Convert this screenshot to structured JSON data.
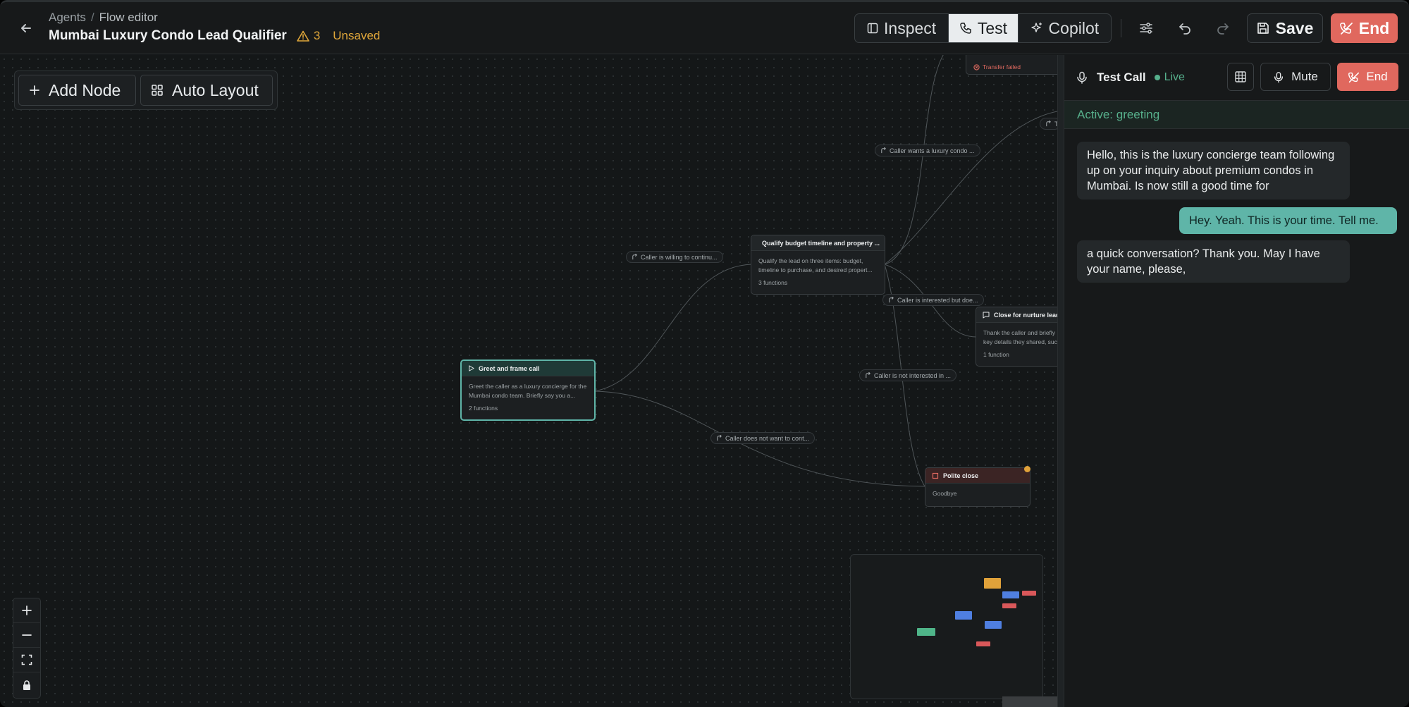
{
  "header": {
    "breadcrumb": {
      "root": "Agents",
      "separator": "/",
      "current": "Flow editor"
    },
    "title": "Mumbai Luxury Condo Lead Qualifier",
    "warning_count": "3",
    "unsaved_label": "Unsaved",
    "modes": [
      {
        "label": "Inspect",
        "icon": "panel-icon",
        "active": false
      },
      {
        "label": "Test",
        "icon": "phone-icon",
        "active": true
      },
      {
        "label": "Copilot",
        "icon": "sparkle-icon",
        "active": false
      }
    ],
    "save_label": "Save",
    "end_label": "End"
  },
  "toolbar": {
    "add_node_label": "Add Node",
    "auto_layout_label": "Auto Layout"
  },
  "flow": {
    "nodes": {
      "greet": {
        "title": "Greet and frame call",
        "body": "Greet the caller as a luxury concierge for the Mumbai condo team. Briefly say you a...",
        "meta": "2 functions"
      },
      "qualify": {
        "title": "Qualify budget timeline and property ...",
        "body": "Qualify the lead on three items: budget, timeline to purchase, and desired propert...",
        "meta": "3 functions"
      },
      "nurture": {
        "title": "Close for nurture lead",
        "body": "Thank the caller and briefly key details they shared, suc",
        "meta": "1 function"
      },
      "polite": {
        "title": "Polite close",
        "body": "Goodbye"
      },
      "transfer": {
        "error": "Transfer failed"
      }
    },
    "edge_labels": {
      "willing": "Caller is willing to continu...",
      "not_continue": "Caller does not want to cont...",
      "luxury": "Caller wants a luxury condo ...",
      "interested_but": "Caller is interested but doe...",
      "not_interested": "Caller is not interested in ...",
      "truncated": "Tr"
    }
  },
  "minimap": {
    "colors": {
      "amber": "#e0a23a",
      "blue": "#4f7fe0",
      "red": "#d9585a",
      "green": "#4fb589"
    }
  },
  "test_panel": {
    "title": "Test Call",
    "status": "Live",
    "mute_label": "Mute",
    "end_label": "End",
    "active_node": "Active: greeting",
    "messages": [
      {
        "role": "agent",
        "text": "Hello, this is the luxury concierge team following up on your inquiry about premium condos in Mumbai. Is now still a good time for"
      },
      {
        "role": "user",
        "text": "Hey. Yeah. This is your time. Tell me."
      },
      {
        "role": "agent",
        "text": "a quick conversation? Thank you. May I have your name, please,"
      }
    ]
  },
  "colors": {
    "accent": "#5fb5a8",
    "danger": "#e0685e",
    "warning": "#e0a73a",
    "live": "#56b08c"
  }
}
